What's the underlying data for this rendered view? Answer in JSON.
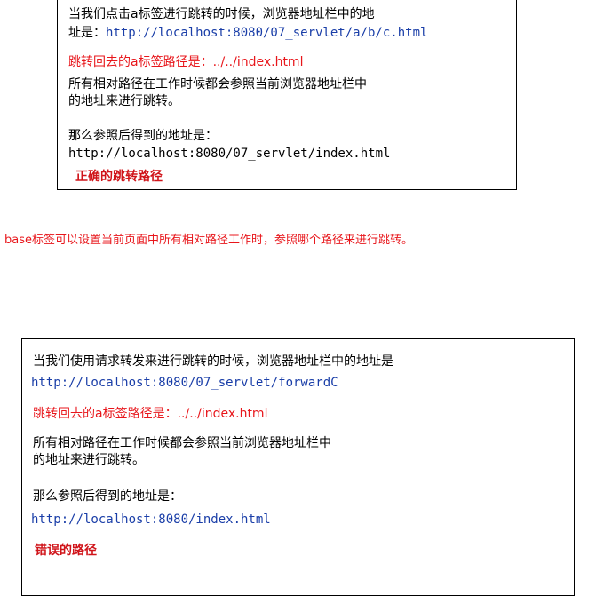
{
  "box1": {
    "line1": "当我们点击a标签进行跳转的时候，浏览器地址栏中的地",
    "line2_prefix": "址是：",
    "line2_url": "http://localhost:8080/07_servlet/a/b/c.html",
    "line3": "跳转回去的a标签路径是：../../index.html",
    "line4": "所有相对路径在工作时候都会参照当前浏览器地址栏中",
    "line5": "的地址来进行跳转。",
    "line6": "那么参照后得到的地址是：",
    "line7": "http://localhost:8080/07_servlet/index.html",
    "verdict": "正确的跳转路径"
  },
  "note": "base标签可以设置当前页面中所有相对路径工作时，参照哪个路径来进行跳转。",
  "box2": {
    "line1": "当我们使用请求转发来进行跳转的时候，浏览器地址栏中的地址是",
    "line2": "http://localhost:8080/07_servlet/forwardC",
    "line3": "跳转回去的a标签路径是：../../index.html",
    "line4": "所有相对路径在工作时候都会参照当前浏览器地址栏中",
    "line5": "的地址来进行跳转。",
    "line6": "那么参照后得到的地址是：",
    "line7": "http://localhost:8080/index.html",
    "verdict": "错误的路径"
  },
  "colors": {
    "blue": "#1a3ea8",
    "red": "#e8161b",
    "dark_red": "#d0141a"
  }
}
